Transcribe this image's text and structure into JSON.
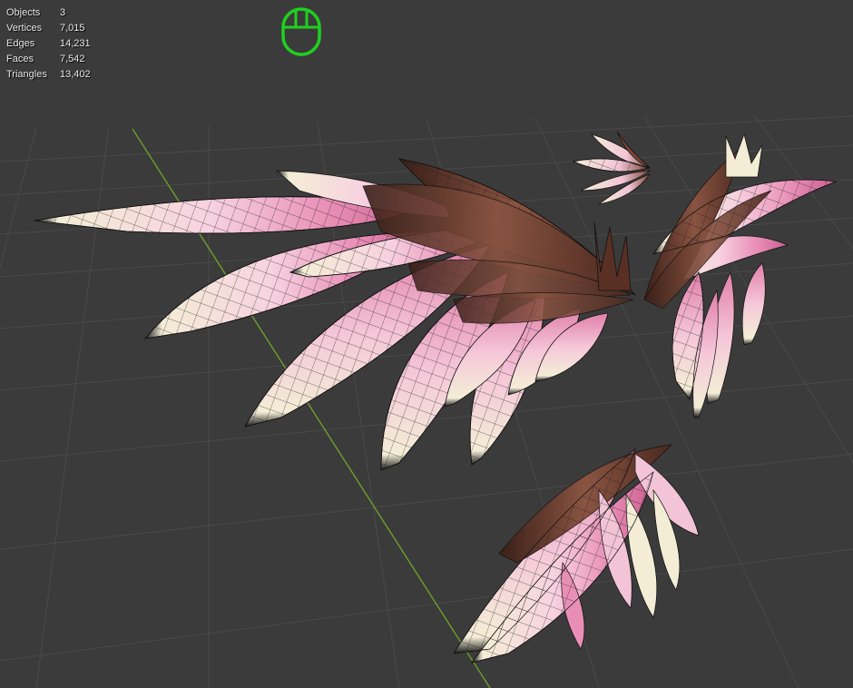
{
  "stats": {
    "rows": [
      {
        "label": "Objects",
        "value": "3"
      },
      {
        "label": "Vertices",
        "value": "7,015"
      },
      {
        "label": "Edges",
        "value": "14,231"
      },
      {
        "label": "Faces",
        "value": "7,542"
      },
      {
        "label": "Triangles",
        "value": "13,402"
      }
    ]
  },
  "colors": {
    "background": "#3b3b3b",
    "grid_line": "#4a4a4a",
    "y_axis": "#6a9a2a",
    "navigation_icon": "#1fd01f",
    "feather_pink": "#e98fb7",
    "feather_cream": "#f2ead4",
    "feather_brown": "#7a4535",
    "wireframe": "#1a1a1a"
  },
  "icons": {
    "navigation": "mouse-icon"
  }
}
